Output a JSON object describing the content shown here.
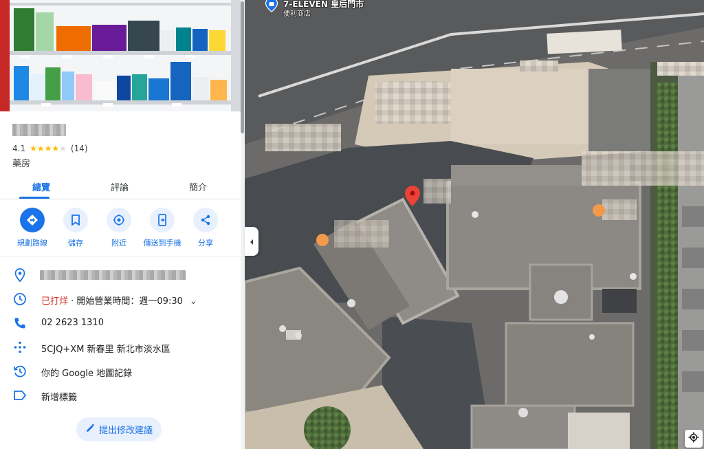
{
  "place": {
    "rating": "4.1",
    "stars_filled": 4,
    "stars_total": 5,
    "review_count": "(14)",
    "category": "藥房"
  },
  "tabs": [
    {
      "label": "總覽",
      "active": true
    },
    {
      "label": "評論",
      "active": false
    },
    {
      "label": "簡介",
      "active": false
    }
  ],
  "actions": [
    {
      "label": "規劃路線",
      "icon": "directions-icon"
    },
    {
      "label": "儲存",
      "icon": "bookmark-icon"
    },
    {
      "label": "附近",
      "icon": "nearby-icon"
    },
    {
      "label": "傳送到手機",
      "icon": "send-to-phone-icon"
    },
    {
      "label": "分享",
      "icon": "share-icon"
    }
  ],
  "info": {
    "hours_status": "已打烊",
    "hours_detail": " · 開始營業時間：週一09:30",
    "phone": "02 2623 1310",
    "plus_code": "5CJQ+XM 新春里 新北市淡水區",
    "history": "你的 Google 地圖記錄",
    "add_label": "新增標籤"
  },
  "suggest_edit": "提出修改建議",
  "map": {
    "poi_name": "7-ELEVEN 皇后門市",
    "poi_type": "便利商店"
  },
  "colors": {
    "accent": "#1a73e8",
    "closed": "#d93025",
    "star": "#fbbc04",
    "pin": "#ea4335"
  }
}
